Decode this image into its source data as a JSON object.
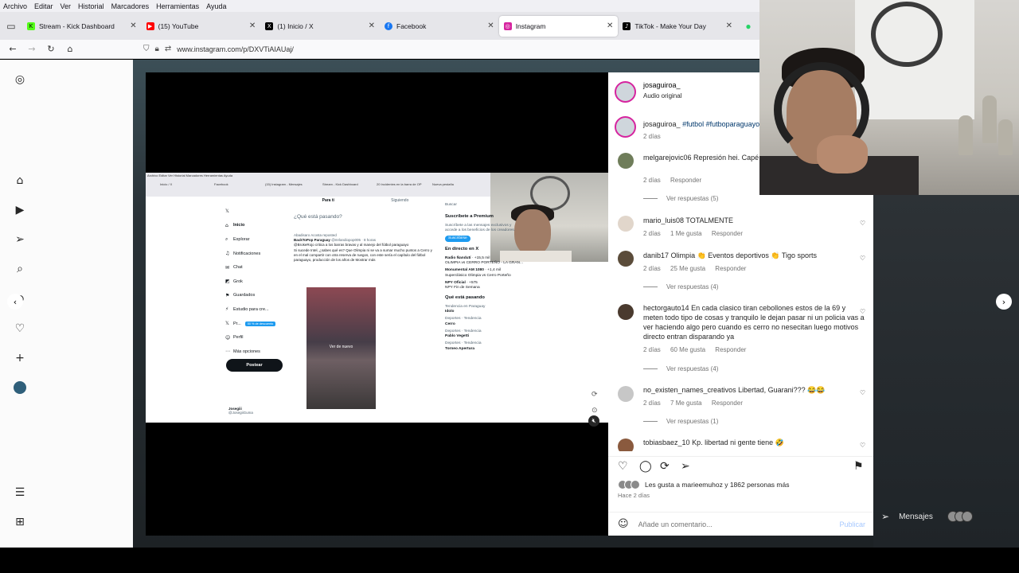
{
  "browser": {
    "menu": [
      "Archivo",
      "Editar",
      "Ver",
      "Historial",
      "Marcadores",
      "Herramientas",
      "Ayuda"
    ],
    "tabs": [
      {
        "label": "Stream - Kick Dashboard",
        "icon": "K",
        "color": "#53fc18"
      },
      {
        "label": "(15) YouTube",
        "icon": "▶",
        "color": "#ff0000"
      },
      {
        "label": "(1) Inicio / X",
        "icon": "X",
        "color": "#000000"
      },
      {
        "label": "Facebook",
        "icon": "f",
        "color": "#1877f2"
      },
      {
        "label": "Instagram",
        "icon": "◎",
        "color": "#d6249f"
      },
      {
        "label": "TikTok - Make Your Day",
        "icon": "♪",
        "color": "#000000"
      }
    ],
    "url": "www.instagram.com/p/DXVTiAIAUaj/"
  },
  "sidebar": {
    "icons": [
      "instagram-icon",
      "home-icon",
      "reels-icon",
      "send-icon",
      "search-icon",
      "explore-icon",
      "heart-icon",
      "plus-icon",
      "profile-icon",
      "menu-icon",
      "apps-icon"
    ]
  },
  "media": {
    "shot_menu": "Archivo  Editar  Ver  Historial  Marcadores  Herramientas  Ayuda",
    "shot_tabs": [
      "Inicio / X",
      "Facebook",
      "(15) Instagram - Mensajes",
      "Stream - Kick Dashboard",
      "20 Incidentes en la barra de OP",
      "Nueva pestaña"
    ],
    "nav": [
      "Inicio",
      "Explorar",
      "Notificaciones",
      "Chat",
      "Grok",
      "Guardados",
      "Estudio para cre...",
      "Pr...",
      "Perfil",
      "Más opciones"
    ],
    "premium_badge": "50 % de descuento",
    "post_button": "Postear",
    "user_name": "Josegiii",
    "user_handle": "@JosegiiGuma",
    "tabs_x": [
      "Para ti",
      "Siguiendo"
    ],
    "compose": "¿Qué está pasando?",
    "tweet_context": "Abadisaro Acosta reposted",
    "tweet_author": "BackToPop Paraguay",
    "tweet_handle": "@mrlandiopop005 · 8 horas",
    "tweet_text": "@BrokeRojo critica a los barras bravas y al manejo del fútbol paraguayo",
    "tweet_text2": "Si sucede Intel, ¿sabes qué es? Que Olimpia ni se va a sumar mucho puntos a Cerro y en el mal compartir con otra reserva de ruegos, con este sería el capítulo del fútbol paraguayo, producción de los años de Mostrar más",
    "video_label": "Ver de nuevo",
    "premium_title": "Suscríbete a Premium",
    "premium_text": "Suscríbete a las mensajes exclusivos y accede a los beneficios de los creadores.",
    "premium_btn": "Suscribirse",
    "live_title": "En directo en X",
    "live_items": [
      {
        "who": "Radio Ñandutí",
        "text": "OLIMPIA vs CERRO PORTEÑO - LA GRAN...",
        "count": "+15,5 mil"
      },
      {
        "who": "Monumental AM 1080",
        "text": "Superclásico Olimpia vs Cerro Porteño",
        "count": "+1,4 mil"
      },
      {
        "who": "NPY Oficial",
        "text": "NPY Fin de Semana",
        "count": "+575"
      }
    ],
    "trends_title": "Qué está pasando",
    "trends": [
      {
        "cat": "Tendencia en Paraguay",
        "name": "Idolo"
      },
      {
        "cat": "Deportes · Tendencia",
        "name": "Cerro"
      },
      {
        "cat": "Deportes · Tendencia",
        "name": "Pablo Vegetti"
      },
      {
        "cat": "Deportes · Tendencia",
        "name": "Torneo Apertura"
      }
    ],
    "search_label": "Buscar"
  },
  "post": {
    "author": "josaguiroa_",
    "audio": "Audio original",
    "caption_user": "josaguiroa_",
    "caption_tags": "#futbol #futboparaguayo",
    "caption_time": "2 días",
    "comments": [
      {
        "user": "melgarejovic06",
        "text": "Represión hei. Capé tenes y decis estupidez 😂😂",
        "time": "2 días",
        "likes": "",
        "reply": "Responder",
        "replies": "Ver respuestas (5)"
      },
      {
        "user": "mario_luis08",
        "text": "TOTALMENTE",
        "time": "2 días",
        "likes": "1 Me gusta",
        "reply": "Responder",
        "replies": ""
      },
      {
        "user": "danib17",
        "text": "Olimpia 👏 Eventos deportivos 👏 Tigo sports",
        "time": "2 días",
        "likes": "25 Me gusta",
        "reply": "Responder",
        "replies": "Ver respuestas (4)"
      },
      {
        "user": "hectorgauto14",
        "text": "En cada clasico tiran cebollones estos de la 69 y meten todo tipo de cosas y tranquilo le dejan pasar ni un policia vas a ver haciendo algo pero cuando es cerro no nesecitan luego motivos directo entran disparando ya",
        "time": "2 días",
        "likes": "60 Me gusta",
        "reply": "Responder",
        "replies": "Ver respuestas (4)"
      },
      {
        "user": "no_existen_names_creativos",
        "text": "Libertad, Guarani??? 😂😂",
        "time": "2 días",
        "likes": "7 Me gusta",
        "reply": "Responder",
        "replies": "Ver respuestas (1)"
      },
      {
        "user": "tobiasbaez_10",
        "text": "Kp. libertad ni gente tiene 🤣",
        "time": "",
        "likes": "",
        "reply": "",
        "replies": ""
      }
    ],
    "likes_prefix": "Les gusta a",
    "likes_user": "marieemuhoz",
    "likes_suffix": "y 1862 personas más",
    "time_ago": "Hace 2 días",
    "comment_placeholder": "Añade un comentario...",
    "publish_label": "Publicar"
  },
  "messages": {
    "label": "Mensajes"
  }
}
